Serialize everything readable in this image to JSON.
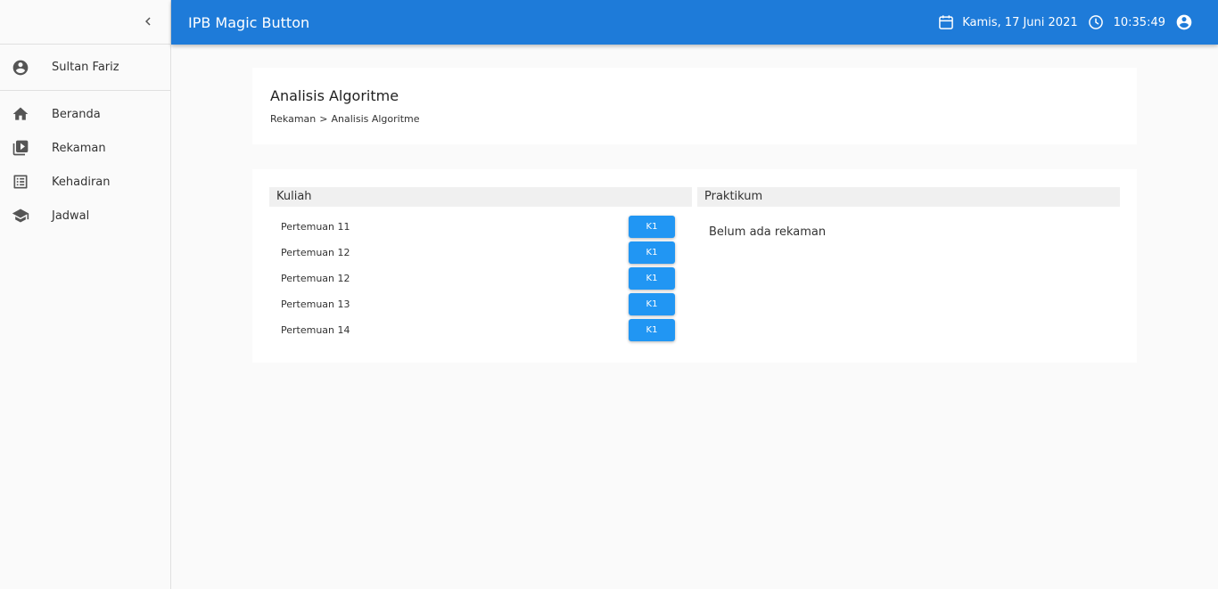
{
  "app": {
    "title": "IPB Magic Button"
  },
  "header": {
    "date": "Kamis, 17 Juni 2021",
    "time": "10:35:49"
  },
  "sidebar": {
    "user": "Sultan Fariz",
    "items": [
      {
        "label": "Beranda",
        "icon": "home-icon"
      },
      {
        "label": "Rekaman",
        "icon": "video-library-icon"
      },
      {
        "label": "Kehadiran",
        "icon": "list-icon"
      },
      {
        "label": "Jadwal",
        "icon": "school-icon"
      }
    ]
  },
  "page": {
    "title": "Analisis Algoritme",
    "breadcrumb": {
      "parent": "Rekaman",
      "separator": ">",
      "current": "Analisis Algoritme"
    }
  },
  "kuliah": {
    "heading": "Kuliah",
    "meetings": [
      {
        "label": "Pertemuan 11",
        "button": "K1"
      },
      {
        "label": "Pertemuan 12",
        "button": "K1"
      },
      {
        "label": "Pertemuan 12",
        "button": "K1"
      },
      {
        "label": "Pertemuan 13",
        "button": "K1"
      },
      {
        "label": "Pertemuan 14",
        "button": "K1"
      }
    ]
  },
  "praktikum": {
    "heading": "Praktikum",
    "empty_message": "Belum ada rekaman"
  },
  "colors": {
    "appbar": "#1e7bd9",
    "button": "#2196f3",
    "background": "#fafafa"
  }
}
